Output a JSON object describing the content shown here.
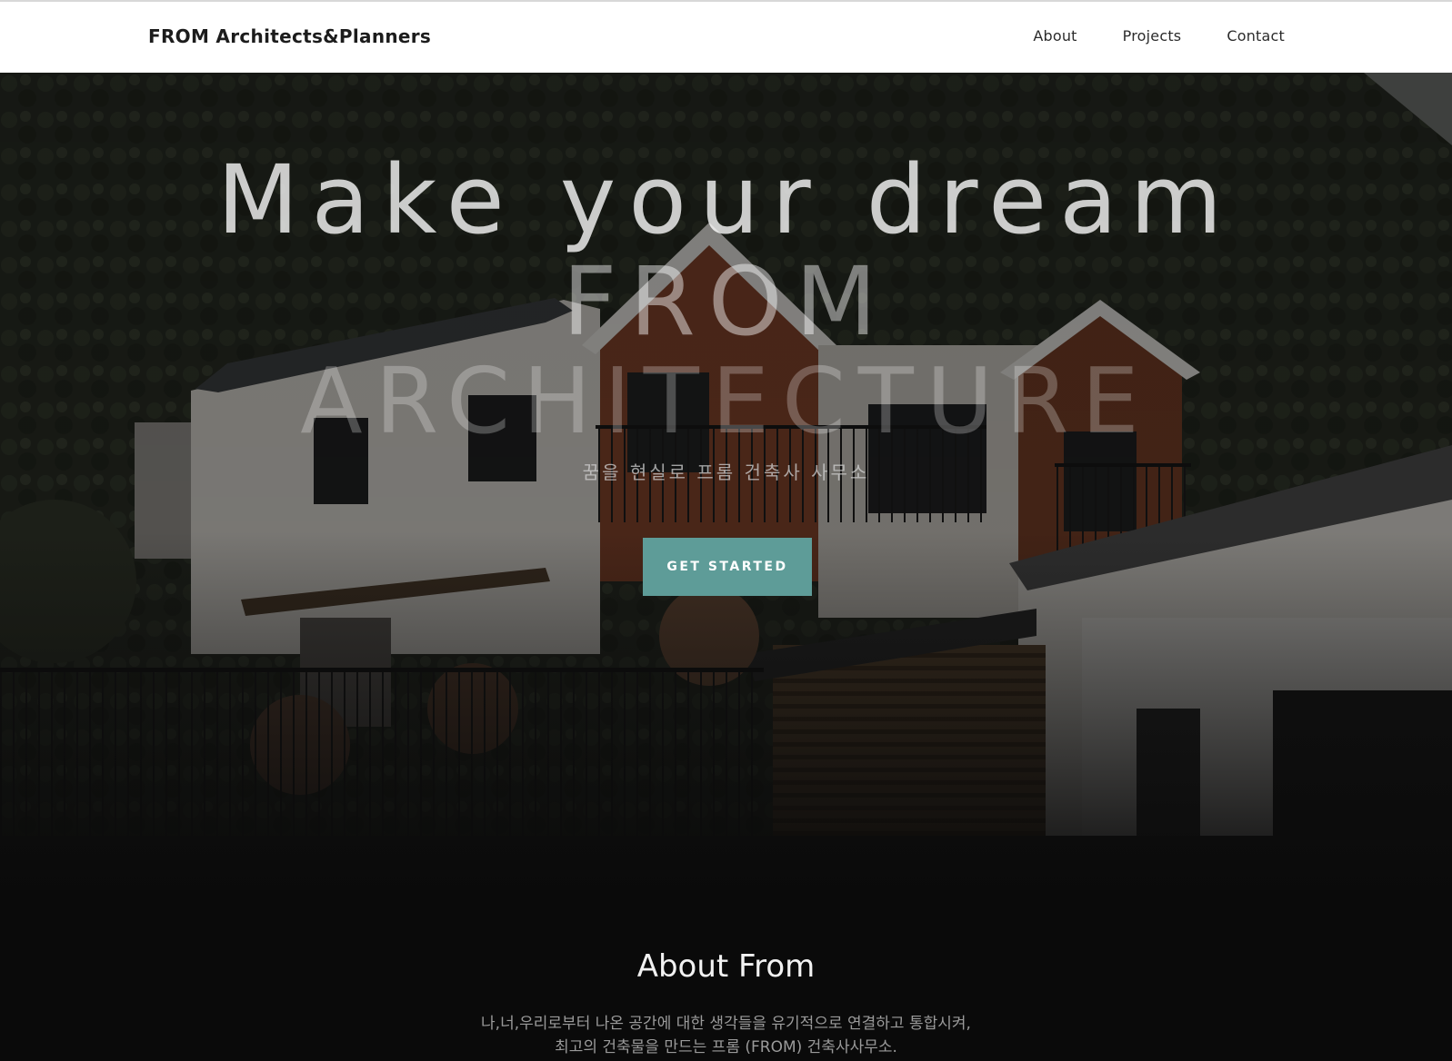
{
  "nav": {
    "brand": "FROM Architects&Planners",
    "links": [
      "About",
      "Projects",
      "Contact"
    ]
  },
  "hero": {
    "title_line1": "Make your dream",
    "title_line2": "FROM",
    "title_line3": "ARCHITECTURE",
    "subtitle": "꿈을 현실로 프롬 건축사 사무소",
    "cta_label": "GET STARTED"
  },
  "about": {
    "title": "About From",
    "line1": "나,너,우리로부터 나온 공간에 대한 생각들을 유기적으로 연결하고 통합시켜,",
    "line2": "최고의 건축물을 만드는 프롬 (FROM) 건축사사무소."
  },
  "colors": {
    "accent": "#5e9c98",
    "navbar_bg": "#ffffff",
    "page_bg": "#0a0a0a"
  }
}
